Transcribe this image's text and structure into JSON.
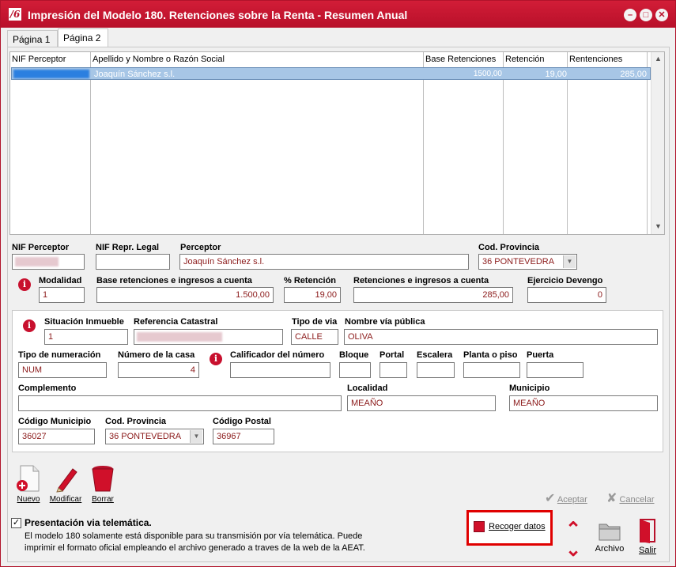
{
  "window": {
    "title": "Impresión del Modelo 180. Retenciones sobre la Renta - Resumen Anual",
    "logo": "logo-icon"
  },
  "tabs": [
    {
      "label": "Página 1"
    },
    {
      "label": "Página 2"
    }
  ],
  "grid": {
    "headers": [
      "NIF Perceptor",
      "Apellido y Nombre o Razón Social",
      "Base Retenciones",
      "Retención",
      "Rentenciones"
    ],
    "rows": [
      {
        "nif": "",
        "nombre": "Joaquín Sánchez s.l.",
        "base": "1500,00",
        "retencion": "19,00",
        "retenciones": "285,00"
      }
    ]
  },
  "form": {
    "nif_perceptor_label": "NIF Perceptor",
    "nif_repr_label": "NIF Repr. Legal",
    "perceptor_label": "Perceptor",
    "perceptor_value": "Joaquín Sánchez s.l.",
    "cod_provincia_label": "Cod. Provincia",
    "cod_provincia_value": "36  PONTEVEDRA",
    "modalidad_label": "Modalidad",
    "modalidad_value": "1",
    "base_label": "Base retenciones e ingresos a cuenta",
    "base_value": "1.500,00",
    "pct_label": "% Retención",
    "pct_value": "19,00",
    "ret_label": "Retenciones e ingresos a cuenta",
    "ret_value": "285,00",
    "ejercicio_label": "Ejercicio Devengo",
    "ejercicio_value": "0"
  },
  "inmueble": {
    "situacion_label": "Situación Inmueble",
    "situacion_value": "1",
    "ref_label": "Referencia Catastral",
    "tipo_via_label": "Tipo de via",
    "tipo_via_value": "CALLE",
    "nombre_via_label": "Nombre vía pública",
    "nombre_via_value": "OLIVA",
    "tipo_num_label": "Tipo de numeración",
    "tipo_num_value": "NUM",
    "num_casa_label": "Número de la casa",
    "num_casa_value": "4",
    "calificador_label": "Calificador del número",
    "bloque_label": "Bloque",
    "portal_label": "Portal",
    "escalera_label": "Escalera",
    "planta_label": "Planta o piso",
    "puerta_label": "Puerta",
    "complemento_label": "Complemento",
    "localidad_label": "Localidad",
    "localidad_value": "MEAÑO",
    "municipio_label": "Municipio",
    "municipio_value": "MEAÑO",
    "cod_municipio_label": "Código Municipio",
    "cod_municipio_value": "36027",
    "cod_provincia_label": "Cod. Provincia",
    "cod_provincia_value": "36  PONTEVEDRA",
    "cod_postal_label": "Código Postal",
    "cod_postal_value": "36967"
  },
  "toolbar": {
    "nuevo": "Nuevo",
    "modificar": "Modificar",
    "borrar": "Borrar",
    "aceptar": "Aceptar",
    "cancelar": "Cancelar"
  },
  "footer": {
    "telematica_label": "Presentación via telemática.",
    "telematica_checked": true,
    "note_line1": "El modelo 180 solamente está disponible para su transmisión por vía telemática. Puede",
    "note_line2": "imprimir el formato oficial empleando el archivo generado a traves de la web de la AEAT.",
    "recoger": "Recoger datos",
    "archivo": "Archivo",
    "salir": "Salir"
  },
  "colors": {
    "brand_red": "#b8102a",
    "selected_row": "#a7c6e6",
    "field_text": "#8b1a1a"
  }
}
